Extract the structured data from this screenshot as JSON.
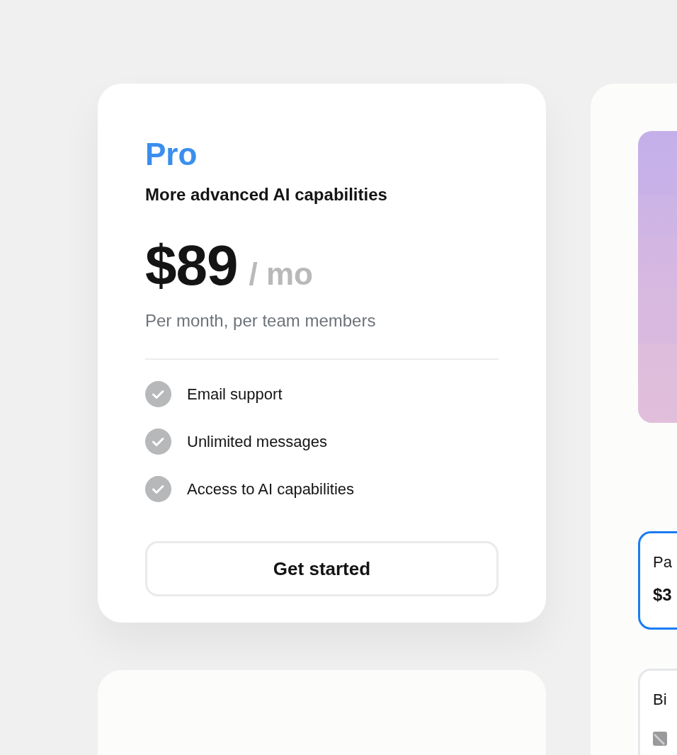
{
  "plan": {
    "name": "Pro",
    "tagline": "More advanced AI capabilities",
    "price": "$89",
    "period": "/ mo",
    "note": "Per month, per team members",
    "features": [
      {
        "label": "Email support"
      },
      {
        "label": "Unlimited messages"
      },
      {
        "label": "Access to AI capabilities"
      }
    ],
    "button": "Get started"
  },
  "side_panel": {
    "options": [
      {
        "label": "Pa",
        "value": "$3",
        "selected": true
      },
      {
        "label": "Bi",
        "selected": false
      }
    ]
  }
}
